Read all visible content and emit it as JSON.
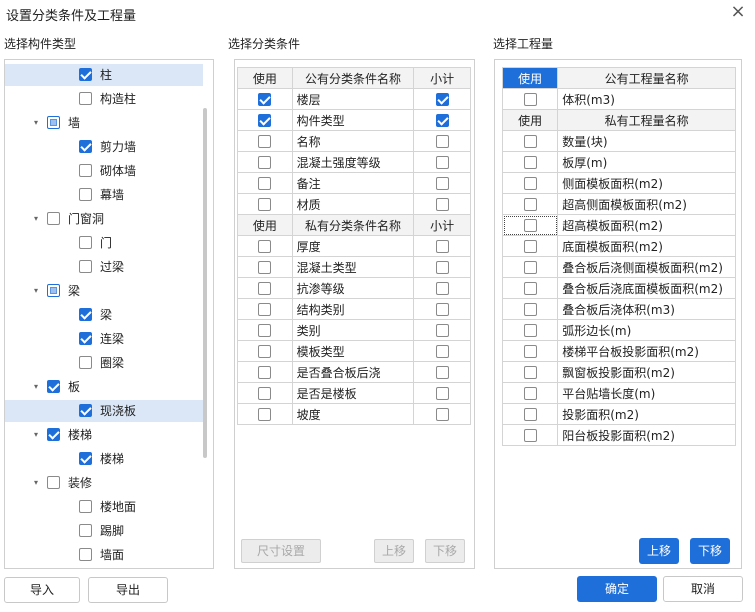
{
  "dialog": {
    "title": "设置分类条件及工程量",
    "close_icon": "×"
  },
  "left": {
    "label": "选择构件类型",
    "items": [
      {
        "label": "柱",
        "level": 1,
        "state": "on",
        "arrow": "",
        "selected": true
      },
      {
        "label": "构造柱",
        "level": 1,
        "state": "off",
        "arrow": ""
      },
      {
        "label": "墙",
        "level": 0,
        "state": "partial",
        "arrow": "▾"
      },
      {
        "label": "剪力墙",
        "level": 1,
        "state": "on",
        "arrow": ""
      },
      {
        "label": "砌体墙",
        "level": 1,
        "state": "off",
        "arrow": ""
      },
      {
        "label": "幕墙",
        "level": 1,
        "state": "off",
        "arrow": ""
      },
      {
        "label": "门窗洞",
        "level": 0,
        "state": "off",
        "arrow": "▾"
      },
      {
        "label": "门",
        "level": 1,
        "state": "off",
        "arrow": ""
      },
      {
        "label": "过梁",
        "level": 1,
        "state": "off",
        "arrow": ""
      },
      {
        "label": "梁",
        "level": 0,
        "state": "partial",
        "arrow": "▾"
      },
      {
        "label": "梁",
        "level": 1,
        "state": "on",
        "arrow": ""
      },
      {
        "label": "连梁",
        "level": 1,
        "state": "on",
        "arrow": ""
      },
      {
        "label": "圈梁",
        "level": 1,
        "state": "off",
        "arrow": ""
      },
      {
        "label": "板",
        "level": 0,
        "state": "on",
        "arrow": "▾"
      },
      {
        "label": "现浇板",
        "level": 1,
        "state": "on",
        "arrow": "",
        "selected": true
      },
      {
        "label": "楼梯",
        "level": 0,
        "state": "on",
        "arrow": "▾"
      },
      {
        "label": "楼梯",
        "level": 1,
        "state": "on",
        "arrow": ""
      },
      {
        "label": "装修",
        "level": 0,
        "state": "off",
        "arrow": "▾"
      },
      {
        "label": "楼地面",
        "level": 1,
        "state": "off",
        "arrow": ""
      },
      {
        "label": "踢脚",
        "level": 1,
        "state": "off",
        "arrow": ""
      },
      {
        "label": "墙面",
        "level": 1,
        "state": "off",
        "arrow": ""
      }
    ],
    "import_label": "导入",
    "export_label": "导出"
  },
  "middle": {
    "label": "选择分类条件",
    "public_header": {
      "use": "使用",
      "name": "公有分类条件名称",
      "subtotal": "小计"
    },
    "public_rows": [
      {
        "name": "楼层",
        "use": true,
        "subtotal": true
      },
      {
        "name": "构件类型",
        "use": true,
        "subtotal": true
      },
      {
        "name": "名称",
        "use": false,
        "subtotal": false
      },
      {
        "name": "混凝土强度等级",
        "use": false,
        "subtotal": false
      },
      {
        "name": "备注",
        "use": false,
        "subtotal": false
      },
      {
        "name": "材质",
        "use": false,
        "subtotal": false
      }
    ],
    "private_header": {
      "use": "使用",
      "name": "私有分类条件名称",
      "subtotal": "小计"
    },
    "private_rows": [
      {
        "name": "厚度",
        "use": false,
        "subtotal": false
      },
      {
        "name": "混凝土类型",
        "use": false,
        "subtotal": false
      },
      {
        "name": "抗渗等级",
        "use": false,
        "subtotal": false
      },
      {
        "name": "结构类别",
        "use": false,
        "subtotal": false
      },
      {
        "name": "类别",
        "use": false,
        "subtotal": false
      },
      {
        "name": "模板类型",
        "use": false,
        "subtotal": false
      },
      {
        "name": "是否叠合板后浇",
        "use": false,
        "subtotal": false
      },
      {
        "name": "是否是楼板",
        "use": false,
        "subtotal": false
      },
      {
        "name": "坡度",
        "use": false,
        "subtotal": false
      }
    ],
    "size_settings_label": "尺寸设置",
    "move_up_label": "上移",
    "move_down_label": "下移"
  },
  "right": {
    "label": "选择工程量",
    "public_header": {
      "use": "使用",
      "name": "公有工程量名称"
    },
    "public_rows": [
      {
        "name": "体积(m3)",
        "use": false
      }
    ],
    "private_header": {
      "use": "使用",
      "name": "私有工程量名称"
    },
    "private_rows": [
      {
        "name": "数量(块)",
        "use": false
      },
      {
        "name": "板厚(m)",
        "use": false
      },
      {
        "name": "侧面模板面积(m2)",
        "use": false
      },
      {
        "name": "超高侧面模板面积(m2)",
        "use": false
      },
      {
        "name": "超高模板面积(m2)",
        "use": false
      },
      {
        "name": "底面模板面积(m2)",
        "use": false
      },
      {
        "name": "叠合板后浇侧面模板面积(m2)",
        "use": false
      },
      {
        "name": "叠合板后浇底面模板面积(m2)",
        "use": false
      },
      {
        "name": "叠合板后浇体积(m3)",
        "use": false
      },
      {
        "name": "弧形边长(m)",
        "use": false
      },
      {
        "name": "楼梯平台板投影面积(m2)",
        "use": false
      },
      {
        "name": "飘窗板投影面积(m2)",
        "use": false
      },
      {
        "name": "平台贴墙长度(m)",
        "use": false
      },
      {
        "name": "投影面积(m2)",
        "use": false
      },
      {
        "name": "阳台板投影面积(m2)",
        "use": false
      }
    ],
    "move_up_label": "上移",
    "move_down_label": "下移"
  },
  "footer": {
    "ok_label": "确定",
    "cancel_label": "取消"
  }
}
